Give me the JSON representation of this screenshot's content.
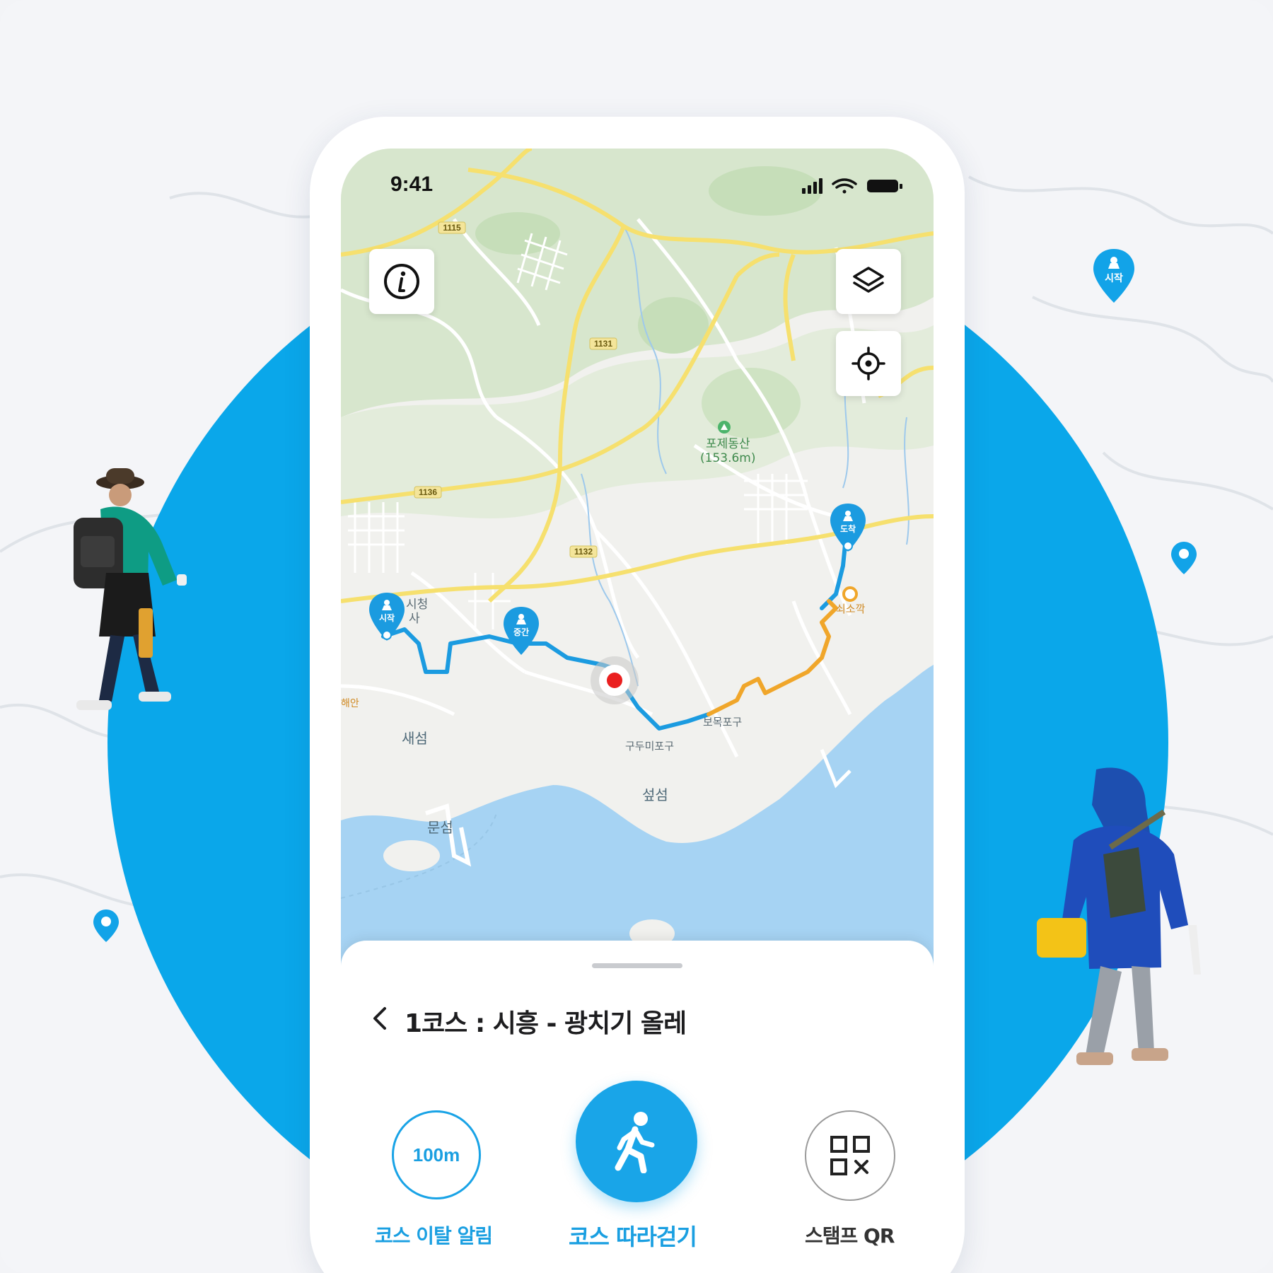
{
  "status": {
    "time": "9:41"
  },
  "map": {
    "road_labels": [
      "1115",
      "1131",
      "1136",
      "1132"
    ],
    "place_labels": {
      "mountain_name": "포제동산",
      "mountain_height": "(153.6m)",
      "city_hall": "시청",
      "city_hall_2": "사",
      "island_1": "새섬",
      "island_2": "섶섬",
      "island_3": "문섬",
      "port_1": "구두미포구",
      "port_2": "보목포구",
      "west_label": "해안",
      "east_label": "쇠소깍"
    },
    "markers": {
      "start": "시작",
      "middle": "중간",
      "end": "도착"
    },
    "route_colors": {
      "walked": "#f0a62a",
      "remaining": "#1b9be0"
    }
  },
  "course": {
    "title": "1코스 : 시흥 - 광치기 올레"
  },
  "actions": {
    "deviation_alert": {
      "badge": "100m",
      "label": "코스 이탈 알림"
    },
    "follow_course": {
      "label": "코스 따라걷기"
    },
    "stamp_qr": {
      "label": "스탬프 QR"
    }
  },
  "decor": {
    "pin_label": "시작"
  },
  "colors": {
    "accent": "#0aa7ea",
    "accent_text": "#1a9fe1"
  }
}
